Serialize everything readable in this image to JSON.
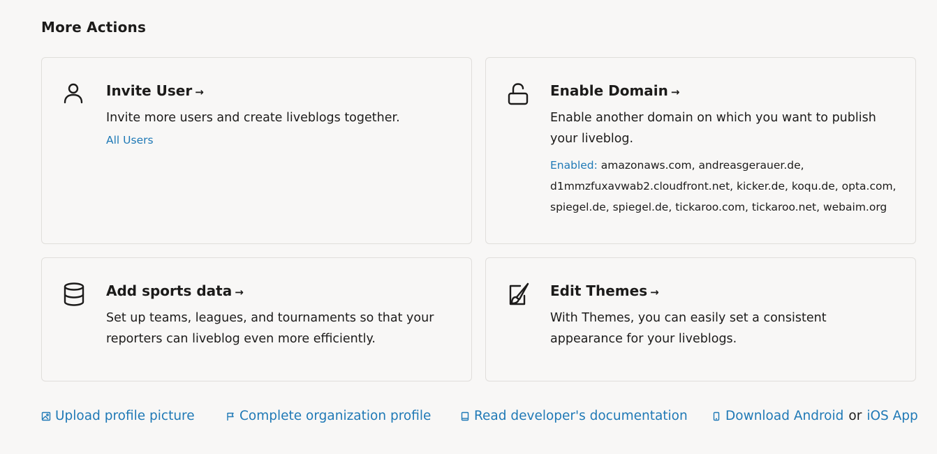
{
  "section": {
    "title": "More Actions"
  },
  "cards": {
    "invite_user": {
      "icon": "user-icon",
      "title": "Invite User",
      "arrow": "→",
      "description": "Invite more users and create liveblogs together.",
      "link": "All Users"
    },
    "enable_domain": {
      "icon": "unlock-icon",
      "title": "Enable Domain",
      "arrow": "→",
      "description": "Enable another domain on which you want to publish your liveblog.",
      "enabled_label": "Enabled:",
      "enabled_domains": "amazonaws.com, andreasgerauer.de, d1mmzfuxavwab2.cloudfront.net, kicker.de, koqu.de, opta.com, spiegel.de, spiegel.de, tickaroo.com, tickaroo.net, webaim.org"
    },
    "sports_data": {
      "icon": "database-icon",
      "title": "Add sports data",
      "arrow": "→",
      "description": "Set up teams, leagues, and tournaments so that your reporters can liveblog even more efficiently."
    },
    "edit_themes": {
      "icon": "paintbrush-icon",
      "title": "Edit Themes",
      "arrow": "→",
      "description": "With Themes, you can easily set a consistent appearance for your liveblogs."
    }
  },
  "footer": {
    "upload_picture": {
      "icon": "image-icon",
      "label": "Upload profile picture"
    },
    "complete_profile": {
      "icon": "flag-icon",
      "label": "Complete organization profile"
    },
    "developer_docs": {
      "icon": "book-icon",
      "label": "Read developer's documentation"
    },
    "download": {
      "icon": "phone-icon",
      "android_label": "Download Android",
      "or_text": "or",
      "ios_label": "iOS App"
    }
  },
  "colors": {
    "link": "#1f79b6",
    "text": "#1c1b1a",
    "background": "#f8f7f6",
    "card_border": "#e0dedb"
  }
}
